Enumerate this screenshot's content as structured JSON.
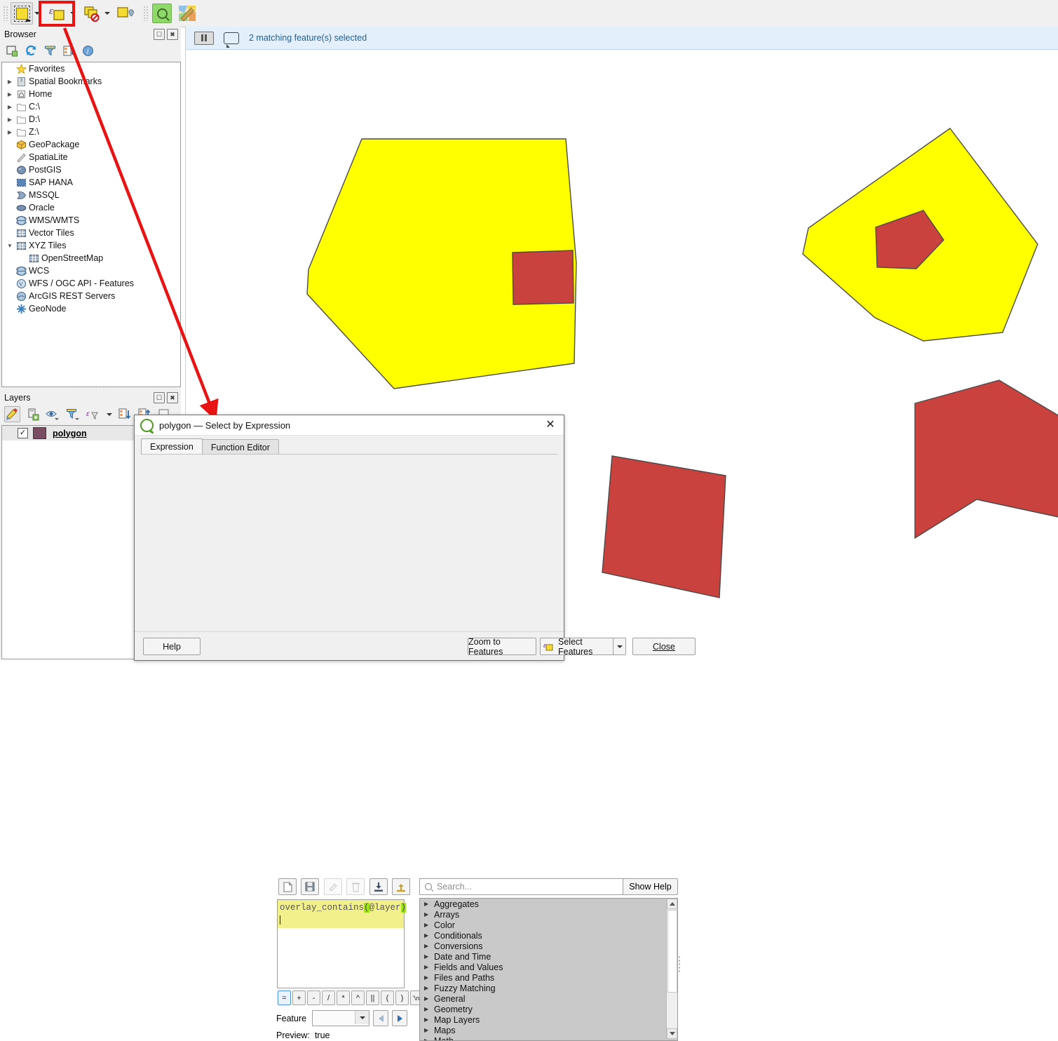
{
  "toolbar": {
    "buttons": [
      {
        "name": "select-features-by-area",
        "label": "Select Features by Area or Single Click"
      },
      {
        "name": "select-by-expression",
        "label": "Select Features by Expression"
      },
      {
        "name": "deselect-features",
        "label": "Deselect Features from All Layers"
      },
      {
        "name": "select-value",
        "label": "Select Value"
      },
      {
        "name": "identify-features",
        "label": "Identify Features"
      },
      {
        "name": "open-attribute-table",
        "label": "Open Attribute Table"
      }
    ],
    "highlight_color": "#e81414"
  },
  "browser": {
    "title": "Browser",
    "tool_icons": [
      "add-layer-icon",
      "refresh-icon",
      "filter-icon",
      "collapse-all-icon",
      "info-icon"
    ],
    "panel_buttons": [
      "undock-icon",
      "close-icon"
    ],
    "items": [
      {
        "label": "Favorites",
        "icon": "star-icon",
        "expandable": false,
        "indent": 0
      },
      {
        "label": "Spatial Bookmarks",
        "icon": "bookmark-icon",
        "expandable": true,
        "indent": 0
      },
      {
        "label": "Home",
        "icon": "home-icon",
        "expandable": true,
        "indent": 0
      },
      {
        "label": "C:\\",
        "icon": "folder-icon",
        "expandable": true,
        "indent": 0
      },
      {
        "label": "D:\\",
        "icon": "folder-icon",
        "expandable": true,
        "indent": 0
      },
      {
        "label": "Z:\\",
        "icon": "folder-icon",
        "expandable": true,
        "indent": 0
      },
      {
        "label": "GeoPackage",
        "icon": "geopackage-icon",
        "expandable": false,
        "indent": 0
      },
      {
        "label": "SpatiaLite",
        "icon": "spatialite-icon",
        "expandable": false,
        "indent": 0
      },
      {
        "label": "PostGIS",
        "icon": "postgis-icon",
        "expandable": false,
        "indent": 0
      },
      {
        "label": "SAP HANA",
        "icon": "saphana-icon",
        "expandable": false,
        "indent": 0
      },
      {
        "label": "MSSQL",
        "icon": "mssql-icon",
        "expandable": false,
        "indent": 0
      },
      {
        "label": "Oracle",
        "icon": "oracle-icon",
        "expandable": false,
        "indent": 0
      },
      {
        "label": "WMS/WMTS",
        "icon": "globe-icon",
        "expandable": false,
        "indent": 0
      },
      {
        "label": "Vector Tiles",
        "icon": "grid-icon",
        "expandable": false,
        "indent": 0
      },
      {
        "label": "XYZ Tiles",
        "icon": "grid-icon",
        "expandable": true,
        "expanded": true,
        "indent": 0
      },
      {
        "label": "OpenStreetMap",
        "icon": "grid-icon",
        "expandable": false,
        "indent": 1
      },
      {
        "label": "WCS",
        "icon": "globe-icon",
        "expandable": false,
        "indent": 0
      },
      {
        "label": "WFS / OGC API - Features",
        "icon": "wfs-icon",
        "expandable": false,
        "indent": 0
      },
      {
        "label": "ArcGIS REST Servers",
        "icon": "arcgis-icon",
        "expandable": false,
        "indent": 0
      },
      {
        "label": "GeoNode",
        "icon": "geonode-icon",
        "expandable": false,
        "indent": 0
      }
    ]
  },
  "layers": {
    "title": "Layers",
    "tool_icons": [
      "style-manager-icon",
      "add-group-icon",
      "eye-icon",
      "filter-icon",
      "expression-filter-icon",
      "expand-all-icon",
      "collapse-all-icon",
      "remove-layer-icon"
    ],
    "panel_buttons": [
      "undock-icon",
      "close-icon"
    ],
    "items": [
      {
        "label": "polygon",
        "checked": true,
        "swatch_color": "#7b4d63"
      }
    ]
  },
  "message_bar": {
    "text": "2 matching feature(s) selected",
    "text_color": "#1d5f96",
    "background": "#e3f0fb"
  },
  "map": {
    "selection_color": "#ffff00",
    "fill_color": "#c9423e",
    "stroke_color": "#4a4a4a",
    "features": [
      {
        "name": "heptagon-selected",
        "selected": true
      },
      {
        "name": "rect-inside-heptagon",
        "selected": false
      },
      {
        "name": "blob-selected",
        "selected": true
      },
      {
        "name": "pentagon-inside-blob",
        "selected": false
      },
      {
        "name": "square-lower-left",
        "selected": false
      },
      {
        "name": "arrow-pentagon-lower-right",
        "selected": false
      }
    ]
  },
  "dialog": {
    "title": "polygon — Select by Expression",
    "logo": "qgis-logo-icon",
    "close_label": "✕",
    "tabs": [
      {
        "label": "Expression",
        "selected": true
      },
      {
        "label": "Function Editor",
        "selected": false
      }
    ],
    "mini_toolbar": [
      {
        "name": "new-file-icon",
        "enabled": true
      },
      {
        "name": "save-icon",
        "enabled": true
      },
      {
        "name": "edit-icon",
        "enabled": false
      },
      {
        "name": "delete-icon",
        "enabled": false
      },
      {
        "name": "import-icon",
        "enabled": true
      },
      {
        "name": "export-icon",
        "enabled": true
      }
    ],
    "search": {
      "placeholder": "Search...",
      "value": "",
      "icon": "search-icon"
    },
    "show_help_label": "Show Help",
    "expression": {
      "text": "overlay_contains(@layer)",
      "part_before": "overlay_contains",
      "paren_open": "(",
      "arg": "@layer",
      "paren_close": ")",
      "highlight_color": "#9fe617",
      "line_background": "#f2f08a"
    },
    "operators": [
      "=",
      "+",
      "-",
      "/",
      "*",
      "^",
      "||",
      "(",
      ")",
      "'\\n'"
    ],
    "selected_operator": "=",
    "feature_label": "Feature",
    "feature_value": "",
    "preview_label": "Preview:",
    "preview_value": "true",
    "function_list": [
      "Aggregates",
      "Arrays",
      "Color",
      "Conditionals",
      "Conversions",
      "Date and Time",
      "Fields and Values",
      "Files and Paths",
      "Fuzzy Matching",
      "General",
      "Geometry",
      "Map Layers",
      "Maps",
      "Math"
    ],
    "footer_buttons": [
      {
        "name": "help-button",
        "label": "Help"
      },
      {
        "name": "zoom-to-features-button",
        "label": "Zoom to Features"
      },
      {
        "name": "select-features-button",
        "label": "Select Features",
        "icon": "select-by-expression-icon"
      },
      {
        "name": "select-features-dropdown",
        "label": "▾"
      },
      {
        "name": "close-button",
        "label": "Close"
      }
    ]
  }
}
